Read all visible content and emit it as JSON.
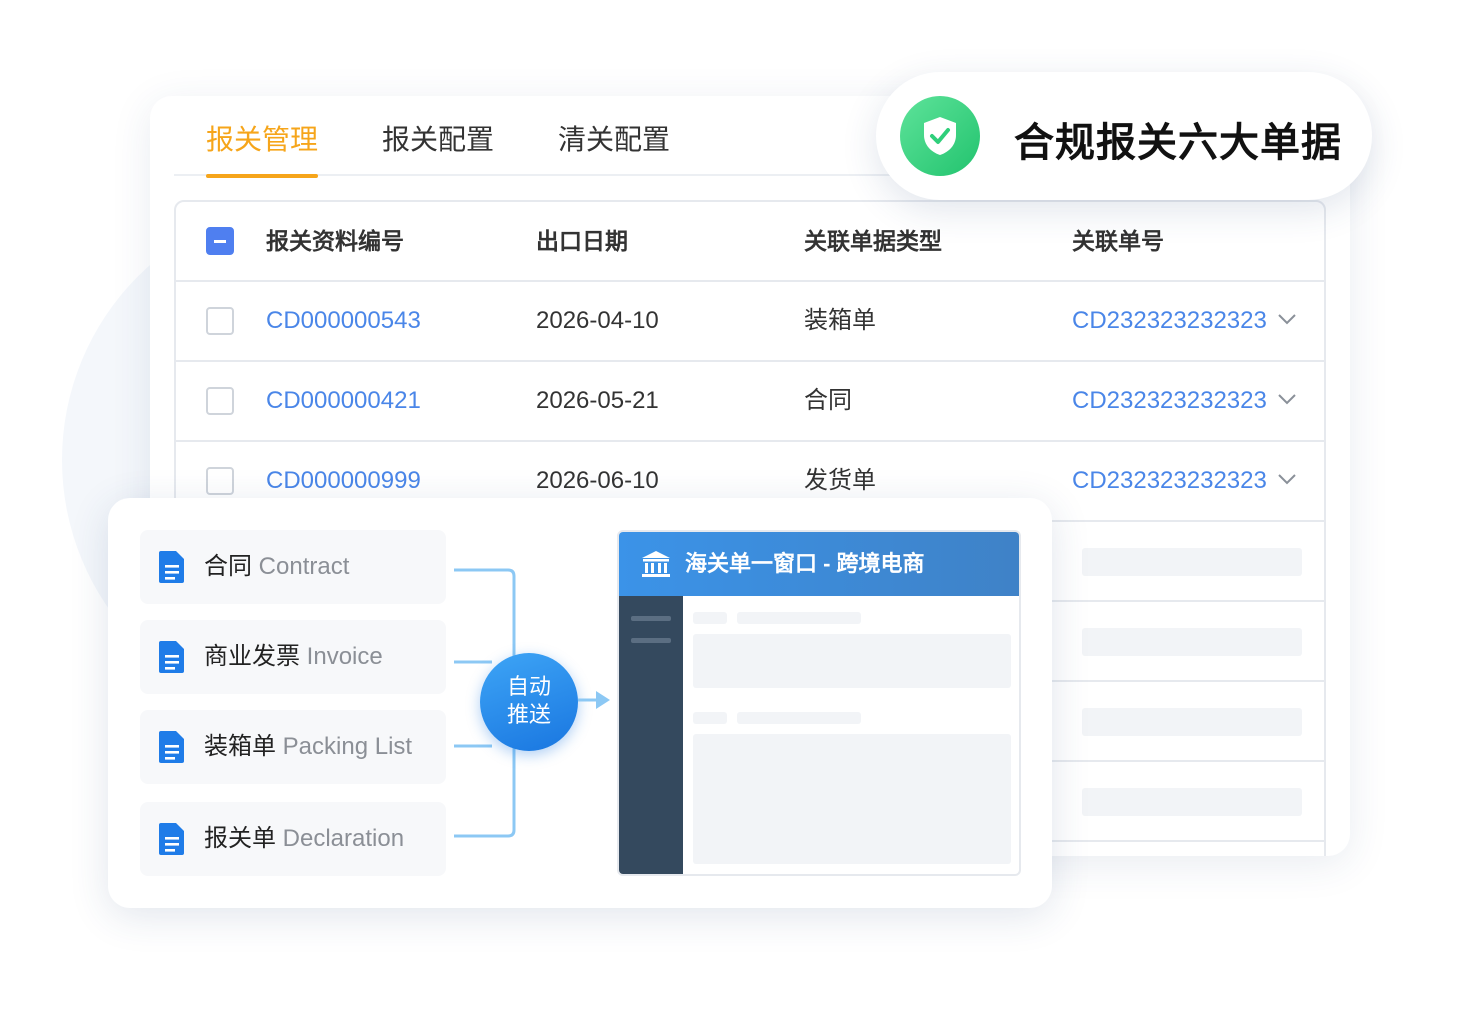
{
  "tabs": [
    {
      "label": "报关管理",
      "active": true
    },
    {
      "label": "报关配置",
      "active": false
    },
    {
      "label": "清关配置",
      "active": false
    }
  ],
  "compliance": {
    "label": "合规报关六大单据"
  },
  "table": {
    "headers": [
      "报关资料编号",
      "出口日期",
      "关联单据类型",
      "关联单号"
    ],
    "rows": [
      {
        "id": "CD000000543",
        "date": "2026-04-10",
        "type": "装箱单",
        "ref": "CD232323232323"
      },
      {
        "id": "CD000000421",
        "date": "2026-05-21",
        "type": "合同",
        "ref": "CD232323232323"
      },
      {
        "id": "CD000000999",
        "date": "2026-06-10",
        "type": "发货单",
        "ref": "CD232323232323"
      }
    ]
  },
  "documents": [
    {
      "cn": "合同",
      "en": "Contract"
    },
    {
      "cn": "商业发票",
      "en": "Invoice"
    },
    {
      "cn": "装箱单",
      "en": "Packing List"
    },
    {
      "cn": "报关单",
      "en": "Declaration"
    }
  ],
  "push": {
    "line1": "自动",
    "line2": "推送"
  },
  "portal": {
    "title": "海关单一窗口 - 跨境电商"
  },
  "colors": {
    "accent": "#f6a51a",
    "link": "#4a86e8",
    "primary": "#1976e0",
    "success": "#22c36e",
    "sidebar": "#34495e"
  },
  "icons": {
    "shield": "shield-check-icon",
    "document": "document-icon",
    "bank": "bank-icon",
    "chevron": "chevron-down-icon",
    "arrow": "arrow-right-icon"
  }
}
